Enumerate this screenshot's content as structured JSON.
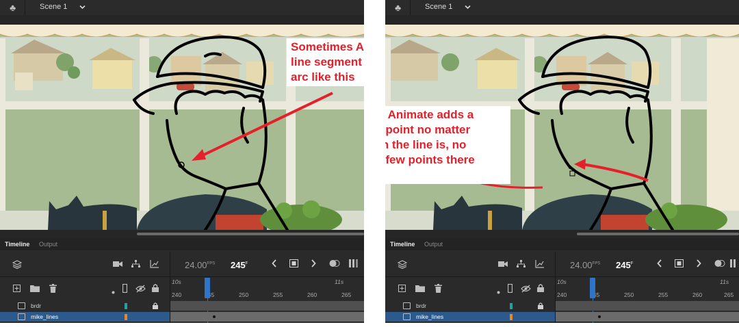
{
  "topbar": {
    "scene_label": "Scene 1"
  },
  "timeline": {
    "tab_timeline": "Timeline",
    "tab_output": "Output",
    "fps_value": "24.00",
    "fps_unit": "FPS",
    "frame_value": "245",
    "frame_unit": "F",
    "ruler_seconds": [
      "10s",
      "11s"
    ],
    "ruler_frames": [
      "240",
      "245",
      "250",
      "255",
      "260",
      "265"
    ],
    "layers": [
      {
        "name": "brdr",
        "color": "#1fa3a3",
        "locked": true
      },
      {
        "name": "mike_lines",
        "color": "#e8862a",
        "locked": false
      }
    ]
  },
  "callouts": {
    "left": "Sometimes Animate edits a\nline segment as a smooth\narc like this",
    "right": "Other times Animate adds a\nnew corner point no matter\nhow smooth the line is, no\nmatter how few points there\nare"
  },
  "icons": [
    "club-icon",
    "chevron-down-icon",
    "layers-icon",
    "camera-icon",
    "hierarchy-icon",
    "graph-icon",
    "prev-frame-icon",
    "stop-icon",
    "next-frame-icon",
    "onion-skin-icon",
    "add-layer-icon",
    "folder-icon",
    "trash-icon",
    "dot-icon",
    "outline-icon",
    "eye-hidden-icon",
    "lock-icon"
  ],
  "colors": {
    "accent_red": "#e4202a",
    "playhead_blue": "#2f74c9",
    "selected_layer": "#2c5a8c"
  }
}
